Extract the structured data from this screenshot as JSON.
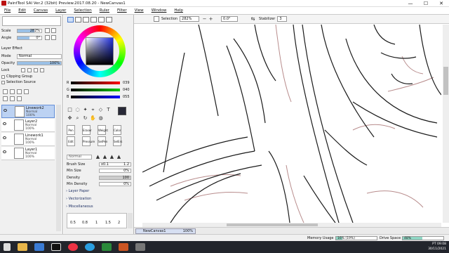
{
  "window": {
    "title": "PaintTool SAI Ver.2 (32bit) Preview.2017.08.20 - NewCanvas1",
    "controls": [
      "—",
      "☐",
      "✕"
    ]
  },
  "menu": [
    "File",
    "Edit",
    "Canvas",
    "Layer",
    "Selection",
    "Ruler",
    "Filter",
    "View",
    "Window",
    "Help"
  ],
  "nav": {
    "scale_label": "Scale",
    "scale_value": "282%",
    "angle_label": "Angle",
    "angle_value": "0°"
  },
  "layer_effect": {
    "header": "Layer Effect",
    "mode_label": "Mode",
    "mode_value": "Normal",
    "opacity_label": "Opacity",
    "opacity_value": "100%",
    "lock_label": "Lock",
    "clipping_label": "Clipping Group",
    "selsource_label": "Selection Source"
  },
  "layers": [
    {
      "name": "Linework2",
      "mode": "Normal",
      "opacity": "100%",
      "selected": true
    },
    {
      "name": "Layer2",
      "mode": "Normal",
      "opacity": "100%",
      "selected": false
    },
    {
      "name": "Linework1",
      "mode": "Normal",
      "opacity": "100%",
      "selected": false
    },
    {
      "name": "Layer1",
      "mode": "Normal",
      "opacity": "100%",
      "selected": false
    }
  ],
  "color": {
    "r_label": "R",
    "r_value": "039",
    "g_label": "G",
    "g_value": "040",
    "b_label": "B",
    "b_value": "055",
    "current": "#272837"
  },
  "brush_groups": [
    [
      "Pen",
      "Eraser",
      "Weight",
      "Color"
    ],
    [
      "Edit",
      "Pressure",
      "SelPen",
      "SelErs"
    ]
  ],
  "brush_settings": {
    "mode_label": "Normal",
    "size_label": "Brush Size",
    "size_mult": "x0.1",
    "size_value": "1.2",
    "minsize_label": "Min Size",
    "minsize_value": "0%",
    "density_label": "Density",
    "density_value": "100",
    "mindensity_label": "Min Density",
    "mindensity_value": "0%"
  },
  "sections": [
    "Layer Paper",
    "Vectorization",
    "Miscellaneous"
  ],
  "brush_sizes": [
    "0.5",
    "0.8",
    "1",
    "1.5",
    "2"
  ],
  "canvas_toolbar": {
    "selection_label": "Selection",
    "zoom_value": "282%",
    "rotate_value": "0.0°",
    "stabilizer_label": "Stabilizer",
    "stabilizer_value": "3"
  },
  "document_tab": {
    "name": "NewCanvas1",
    "zoom": "100%"
  },
  "status": {
    "memory_label": "Memory Usage",
    "memory_value": "16% (19%)",
    "memory_level": 16,
    "drive_label": "Drive Space",
    "drive_value": "48%",
    "drive_level": 48
  },
  "taskbar": {
    "time": "09:08",
    "date": "30/11/2021",
    "lang": "PT"
  }
}
